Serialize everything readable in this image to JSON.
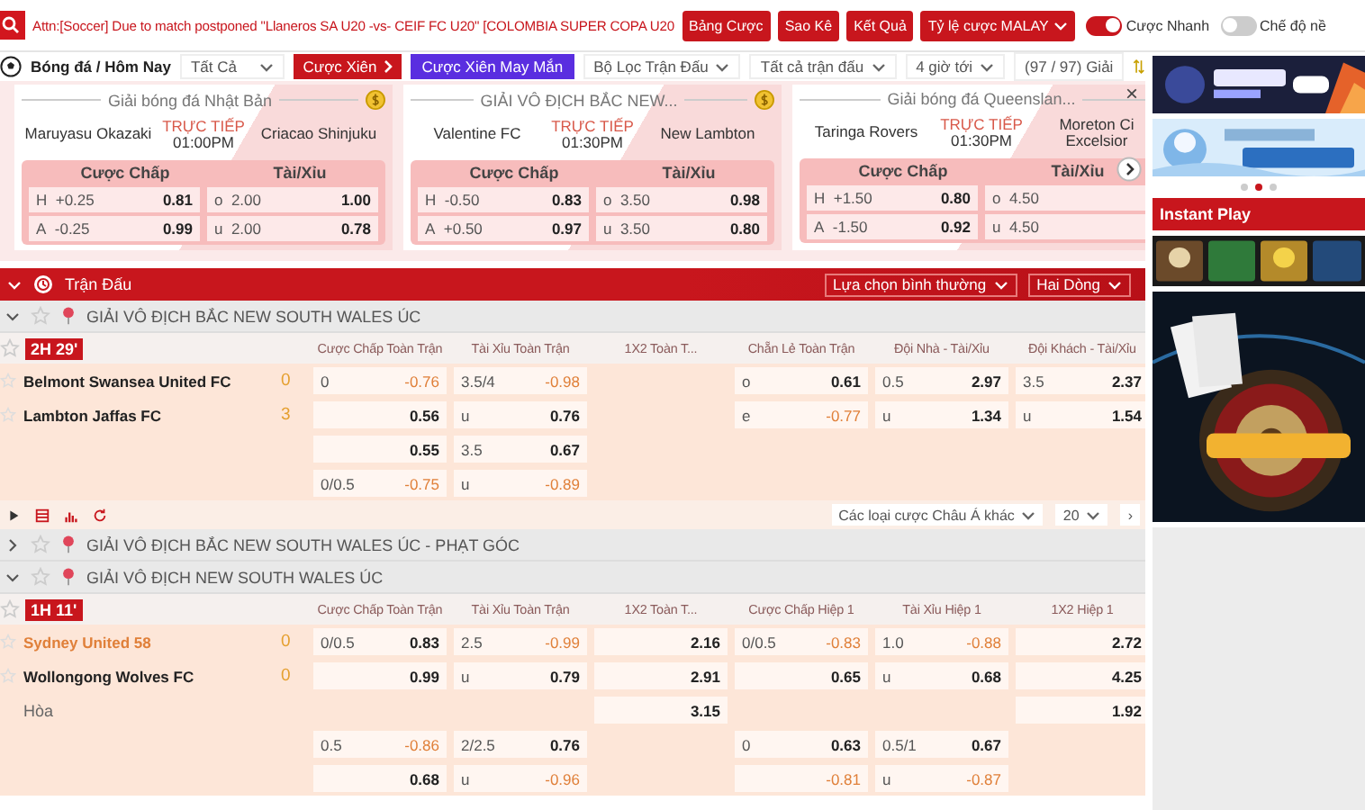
{
  "ticker": "Attn:[Soccer] Due to match postponed \"Llaneros SA U20 -vs- CEIF FC U20\" [COLOMBIA SUPER COPA U20",
  "top_buttons": [
    {
      "label": "Bảng Cược",
      "dropdown": false
    },
    {
      "label": "Sao Kê",
      "dropdown": false
    },
    {
      "label": "Kết Quả",
      "dropdown": false
    },
    {
      "label": "Tỷ lệ cược MALAY",
      "dropdown": true
    }
  ],
  "toggles": [
    {
      "label": "Cược Nhanh",
      "on": true
    },
    {
      "label": "Chế độ nề",
      "on": false
    }
  ],
  "filter_bar": {
    "breadcrumb": "Bóng đá / Hôm Nay",
    "market_select": "Tất Cả",
    "parlay_button": "Cược Xiên",
    "lucky_parlay_button": "Cược Xiên May Mắn",
    "dropdowns": [
      "Bộ Lọc Trận Đấu",
      "Tất cả trận đấu",
      "4 giờ tới"
    ],
    "league_count": "(97 / 97) Giải"
  },
  "featured": {
    "close": "×",
    "cards": [
      {
        "league": "Giải bóng đá Nhật Bản",
        "coin": true,
        "home": "Maruyasu Okazaki",
        "away": "Criacao Shinjuku",
        "status": "TRỰC TIẾP",
        "time": "01:00PM",
        "handicap_title": "Cược Chấp",
        "ou_title": "Tài/Xỉu",
        "handicap": [
          {
            "side": "H",
            "line": "+0.25",
            "odds": "0.81"
          },
          {
            "side": "A",
            "line": "-0.25",
            "odds": "0.99"
          }
        ],
        "over_under": [
          {
            "side": "o",
            "line": "2.00",
            "odds": "1.00"
          },
          {
            "side": "u",
            "line": "2.00",
            "odds": "0.78"
          }
        ]
      },
      {
        "league": "GIẢI VÔ ĐỊCH BẮC NEW...",
        "coin": true,
        "home": "Valentine FC",
        "away": "New Lambton",
        "status": "TRỰC TIẾP",
        "time": "01:30PM",
        "handicap_title": "Cược Chấp",
        "ou_title": "Tài/Xỉu",
        "handicap": [
          {
            "side": "H",
            "line": "-0.50",
            "odds": "0.83"
          },
          {
            "side": "A",
            "line": "+0.50",
            "odds": "0.97"
          }
        ],
        "over_under": [
          {
            "side": "o",
            "line": "3.50",
            "odds": "0.98"
          },
          {
            "side": "u",
            "line": "3.50",
            "odds": "0.80"
          }
        ]
      },
      {
        "league": "Giải bóng đá Queenslan...",
        "coin": false,
        "home": "Taringa Rovers",
        "away": "Moreton Ci\nExcelsior",
        "status": "TRỰC TIẾP",
        "time": "01:30PM",
        "handicap_title": "Cược Chấp",
        "ou_title": "Tài/Xỉu",
        "handicap": [
          {
            "side": "H",
            "line": "+1.50",
            "odds": "0.80"
          },
          {
            "side": "A",
            "line": "-1.50",
            "odds": "0.92"
          }
        ],
        "over_under": [
          {
            "side": "o",
            "line": "4.50"
          },
          {
            "side": "u",
            "line": "4.50"
          }
        ]
      }
    ]
  },
  "section": {
    "title": "Trận Đấu",
    "view_select": "Lựa chọn bình thường",
    "rows_select": "Hai Dòng"
  },
  "leagues": [
    {
      "name": "GIẢI VÔ ĐỊCH BẮC NEW SOUTH WALES ÚC",
      "expanded": true,
      "match": {
        "status": "2H 29'",
        "columns": [
          "Cược Chấp Toàn Trận",
          "Tài Xỉu Toàn Trận",
          "1X2 Toàn T...",
          "Chẵn Lẻ Toàn Trận",
          "Đội Nhà - Tài/Xỉu",
          "Đội Khách - Tài/Xỉu"
        ],
        "rows": [
          {
            "kind": "team",
            "team": "Belmont Swansea United FC",
            "highlighted": false,
            "score": "0",
            "cells": [
              {
                "line": "0",
                "odds": "-0.76",
                "negative": true
              },
              {
                "line": "3.5/4",
                "odds": "-0.98",
                "negative": true
              },
              null,
              {
                "line": "o",
                "odds": "0.61",
                "negative": false
              },
              {
                "line": "0.5",
                "odds": "2.97",
                "negative": false
              },
              {
                "line": "3.5",
                "odds": "2.37",
                "negative": false
              }
            ]
          },
          {
            "kind": "team",
            "team": "Lambton Jaffas FC",
            "highlighted": false,
            "score": "3",
            "cells": [
              {
                "odds": "0.56",
                "negative": false
              },
              {
                "line": "u",
                "odds": "0.76",
                "negative": false
              },
              null,
              {
                "line": "e",
                "odds": "-0.77",
                "negative": true
              },
              {
                "line": "u",
                "odds": "1.34",
                "negative": false
              },
              {
                "line": "u",
                "odds": "1.54",
                "negative": false
              }
            ]
          },
          {
            "kind": "line",
            "cells": [
              {
                "odds": "0.55",
                "negative": false
              },
              {
                "line": "3.5",
                "odds": "0.67",
                "negative": false
              },
              null,
              null,
              null,
              null
            ]
          },
          {
            "kind": "line",
            "cells": [
              {
                "line": "0/0.5",
                "odds": "-0.75",
                "negative": true
              },
              {
                "line": "u",
                "odds": "-0.89",
                "negative": true
              },
              null,
              null,
              null,
              null
            ]
          }
        ],
        "footer": {
          "more_select": "Các loại cược Châu Á khác",
          "page_size": "20",
          "next": "›"
        }
      }
    },
    {
      "name": "GIẢI VÔ ĐỊCH BẮC NEW SOUTH WALES ÚC - PHẠT GÓC",
      "expanded": false
    },
    {
      "name": "GIẢI VÔ ĐỊCH NEW SOUTH WALES ÚC",
      "expanded": true,
      "match": {
        "status": "1H 11'",
        "columns": [
          "Cược Chấp Toàn Trận",
          "Tài Xỉu Toàn Trận",
          "1X2 Toàn T...",
          "Cược Chấp Hiệp 1",
          "Tài Xỉu Hiệp 1",
          "1X2 Hiệp 1"
        ],
        "rows": [
          {
            "kind": "team",
            "team": "Sydney United 58",
            "highlighted": true,
            "score": "0",
            "cells": [
              {
                "line": "0/0.5",
                "odds": "0.83",
                "negative": false
              },
              {
                "line": "2.5",
                "odds": "-0.99",
                "negative": true
              },
              {
                "odds": "2.16",
                "negative": false
              },
              {
                "line": "0/0.5",
                "odds": "-0.83",
                "negative": true
              },
              {
                "line": "1.0",
                "odds": "-0.88",
                "negative": true
              },
              {
                "odds": "2.72",
                "negative": false
              }
            ]
          },
          {
            "kind": "team",
            "team": "Wollongong Wolves FC",
            "highlighted": false,
            "score": "0",
            "cells": [
              {
                "odds": "0.99",
                "negative": false
              },
              {
                "line": "u",
                "odds": "0.79",
                "negative": false
              },
              {
                "odds": "2.91",
                "negative": false
              },
              {
                "odds": "0.65",
                "negative": false
              },
              {
                "line": "u",
                "odds": "0.68",
                "negative": false
              },
              {
                "odds": "4.25",
                "negative": false
              }
            ]
          },
          {
            "kind": "draw",
            "team": "Hòa",
            "cells": [
              null,
              null,
              {
                "odds": "3.15",
                "negative": false
              },
              null,
              null,
              {
                "odds": "1.92",
                "negative": false
              }
            ]
          },
          {
            "kind": "line",
            "cells": [
              {
                "line": "0.5",
                "odds": "-0.86",
                "negative": true
              },
              {
                "line": "2/2.5",
                "odds": "0.76",
                "negative": false
              },
              null,
              {
                "line": "0",
                "odds": "0.63",
                "negative": false
              },
              {
                "line": "0.5/1",
                "odds": "0.67",
                "negative": false
              },
              null
            ]
          },
          {
            "kind": "line",
            "cells": [
              {
                "odds": "0.68",
                "negative": false
              },
              {
                "line": "u",
                "odds": "-0.96",
                "negative": true
              },
              null,
              {
                "odds": "-0.81",
                "negative": true
              },
              {
                "line": "u",
                "odds": "-0.87",
                "negative": true
              },
              null
            ]
          }
        ]
      }
    }
  ],
  "sidebar": {
    "carousel": [
      {
        "selected": false
      },
      {
        "selected": true
      },
      {
        "selected": false
      }
    ],
    "instant_play": "Instant Play"
  }
}
